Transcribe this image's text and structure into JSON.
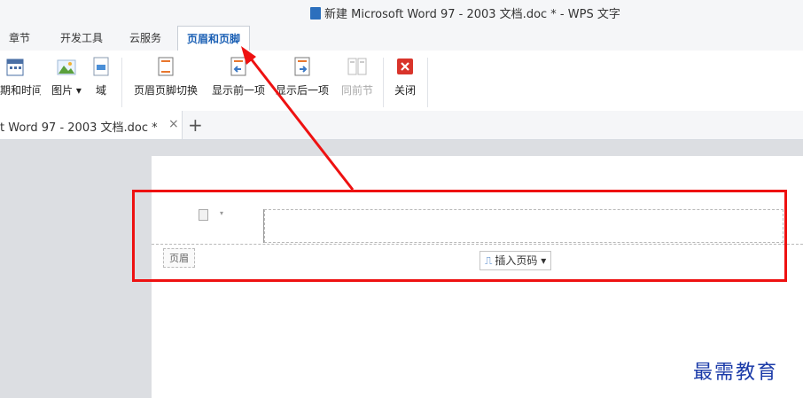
{
  "window": {
    "title": "新建 Microsoft Word 97 - 2003 文档.doc * - WPS 文字"
  },
  "menu_tabs": [
    {
      "label": "章节"
    },
    {
      "label": "开发工具"
    },
    {
      "label": "云服务"
    },
    {
      "label": "页眉和页脚",
      "active": true
    }
  ],
  "ribbon": {
    "date_time": "日期和时间",
    "picture": "图片",
    "field": "域",
    "switch_header_footer": "页眉页脚切换",
    "show_previous": "显示前一项",
    "show_next": "显示后一项",
    "same_as_previous": "同前节",
    "close": "关闭"
  },
  "doc_tab": {
    "label": "t Word 97 - 2003 文档.doc *",
    "close": "×",
    "new": "+"
  },
  "header_area": {
    "tag": "页眉",
    "insert_page_number": "插入页码"
  },
  "watermark": "最需教育",
  "colors": {
    "annotation_red": "#ee1111",
    "active_tab_text": "#1a5fb4",
    "watermark": "#1a3aa8"
  }
}
